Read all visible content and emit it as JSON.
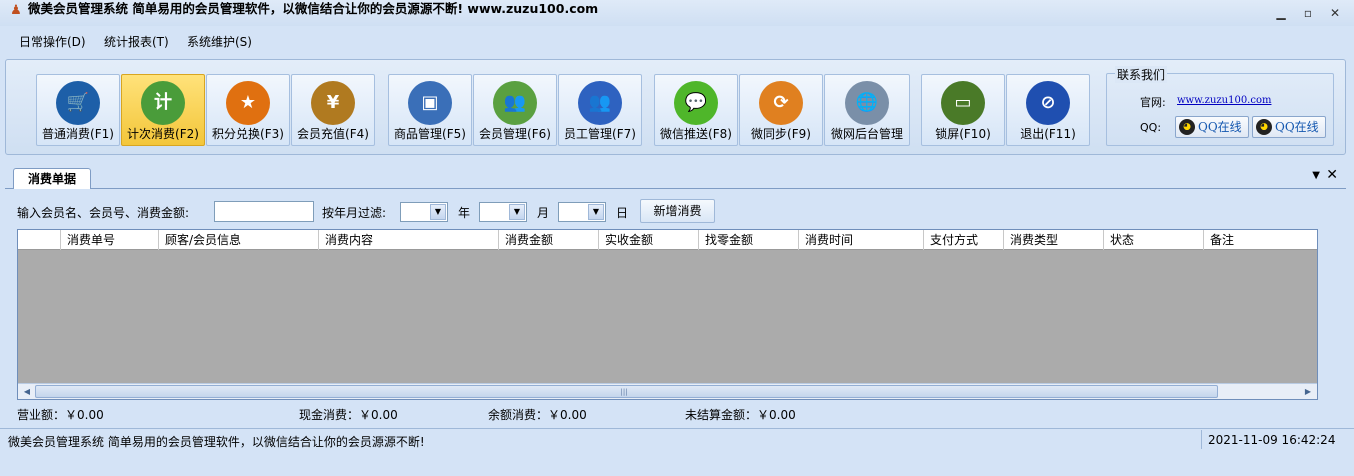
{
  "window": {
    "title": "微美会员管理系统    简单易用的会员管理软件，以微信结合让你的会员源源不断!   www.zuzu100.com",
    "minimize": "▁",
    "maximize": "▫",
    "close": "✕"
  },
  "menu": [
    {
      "label": "日常操作(D)"
    },
    {
      "label": "统计报表(T)"
    },
    {
      "label": "系统维护(S)"
    }
  ],
  "toolbar": {
    "buttons": [
      {
        "label": "普通消费(F1)",
        "icon": "cart-icon",
        "glyph": "🛒",
        "color": "#1d5fa8"
      },
      {
        "label": "计次消费(F2)",
        "icon": "sale-tag-icon",
        "glyph": "计",
        "color": "#4a9c3a",
        "active": true
      },
      {
        "label": "积分兑换(F3)",
        "icon": "star-icon",
        "glyph": "★",
        "color": "#e07010"
      },
      {
        "label": "会员充值(F4)",
        "icon": "yuan-icon",
        "glyph": "¥",
        "color": "#b07a20"
      },
      {
        "label": "商品管理(F5)",
        "icon": "briefcase-icon",
        "glyph": "▣",
        "color": "#3a6fb8"
      },
      {
        "label": "会员管理(F6)",
        "icon": "users-green-icon",
        "glyph": "👥",
        "color": "#5aa040"
      },
      {
        "label": "员工管理(F7)",
        "icon": "users-blue-icon",
        "glyph": "👥",
        "color": "#2e62c0"
      },
      {
        "label": "微信推送(F8)",
        "icon": "wechat-icon",
        "glyph": "💬",
        "color": "#4fb62a"
      },
      {
        "label": "微同步(F9)",
        "icon": "sync-icon",
        "glyph": "⟳",
        "color": "#e08020"
      },
      {
        "label": "微网后台管理",
        "icon": "web-folder-icon",
        "glyph": "🌐",
        "color": "#7a8fa8"
      },
      {
        "label": "锁屏(F10)",
        "icon": "monitor-icon",
        "glyph": "▭",
        "color": "#4a7a28"
      },
      {
        "label": "退出(F11)",
        "icon": "exit-icon",
        "glyph": "⊘",
        "color": "#1f4fb0"
      }
    ]
  },
  "contact": {
    "title": "联系我们",
    "site_label": "官网:",
    "site_url": "www.zuzu100.com",
    "qq_label": "QQ:",
    "qq_button_1": "QQ在线",
    "qq_button_2": "QQ在线"
  },
  "tab": {
    "label": "消费单据",
    "menu_icon": "▼",
    "close_icon": "✕"
  },
  "filter": {
    "search_label": "输入会员名、会员号、消费金额:",
    "search_value": "",
    "ym_label": "按年月过滤:",
    "year_unit": "年",
    "month_unit": "月",
    "day_unit": "日",
    "year_value": "",
    "month_value": "",
    "day_value": "",
    "add_button": "新增消费"
  },
  "grid": {
    "columns": [
      "消费单号",
      "顾客/会员信息",
      "消费内容",
      "消费金额",
      "实收金额",
      "找零金额",
      "消费时间",
      "支付方式",
      "消费类型",
      "状态",
      "备注"
    ],
    "rows": []
  },
  "summary": {
    "revenue": "营业额：￥0.00",
    "cash": "现金消费：￥0.00",
    "balance": "余额消费：￥0.00",
    "unsettled": "未结算金额：￥0.00"
  },
  "statusbar": {
    "text": "微美会员管理系统 简单易用的会员管理软件，以微信结合让你的会员源源不断!",
    "time": "2021-11-09 16:42:24"
  }
}
